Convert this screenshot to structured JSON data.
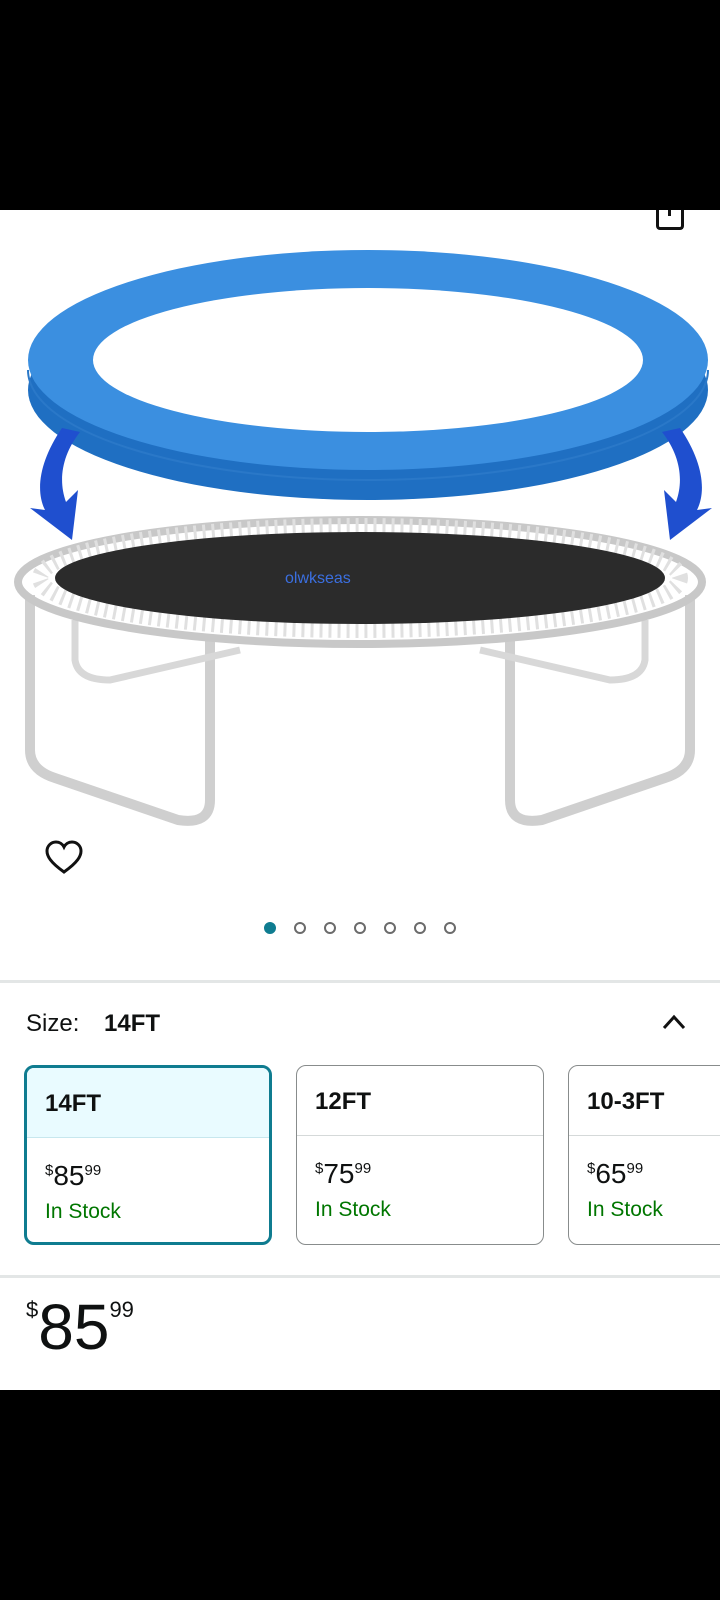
{
  "carousel": {
    "total_images": 7,
    "active_index": 0,
    "brand_text": "olwkseas"
  },
  "size": {
    "label": "Size:",
    "selected": "14FT",
    "options": [
      {
        "name": "14FT",
        "currency": "$",
        "whole": "85",
        "fraction": "99",
        "stock": "In Stock"
      },
      {
        "name": "12FT",
        "currency": "$",
        "whole": "75",
        "fraction": "99",
        "stock": "In Stock"
      },
      {
        "name": "10-3FT",
        "currency": "$",
        "whole": "65",
        "fraction": "99",
        "stock": "In Stock"
      }
    ]
  },
  "price": {
    "currency": "$",
    "whole": "85",
    "fraction": "99"
  },
  "colors": {
    "accent": "#0f7c90",
    "stock_green": "#007600",
    "pad_blue": "#2f86d6",
    "mat": "#222222"
  }
}
